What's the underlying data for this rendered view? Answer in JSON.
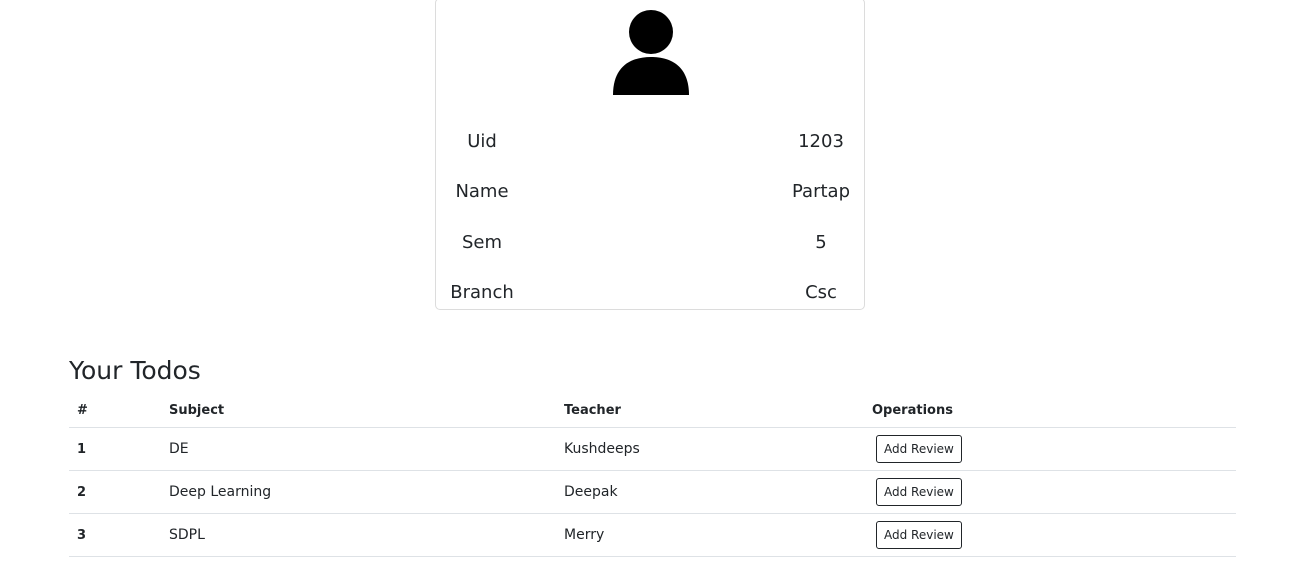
{
  "profile": {
    "avatar_icon": "user-icon",
    "fields": [
      {
        "label": "Uid",
        "value": "1203"
      },
      {
        "label": "Name",
        "value": "Partap"
      },
      {
        "label": "Sem",
        "value": "5"
      },
      {
        "label": "Branch",
        "value": "Csc"
      }
    ]
  },
  "todos": {
    "title": "Your Todos",
    "headers": {
      "num": "#",
      "subject": "Subject",
      "teacher": "Teacher",
      "operations": "Operations"
    },
    "rows": [
      {
        "num": "1",
        "subject": "DE",
        "teacher": "Kushdeeps",
        "action": "Add Review"
      },
      {
        "num": "2",
        "subject": "Deep Learning",
        "teacher": "Deepak",
        "action": "Add Review"
      },
      {
        "num": "3",
        "subject": "SDPL",
        "teacher": "Merry",
        "action": "Add Review"
      }
    ]
  }
}
